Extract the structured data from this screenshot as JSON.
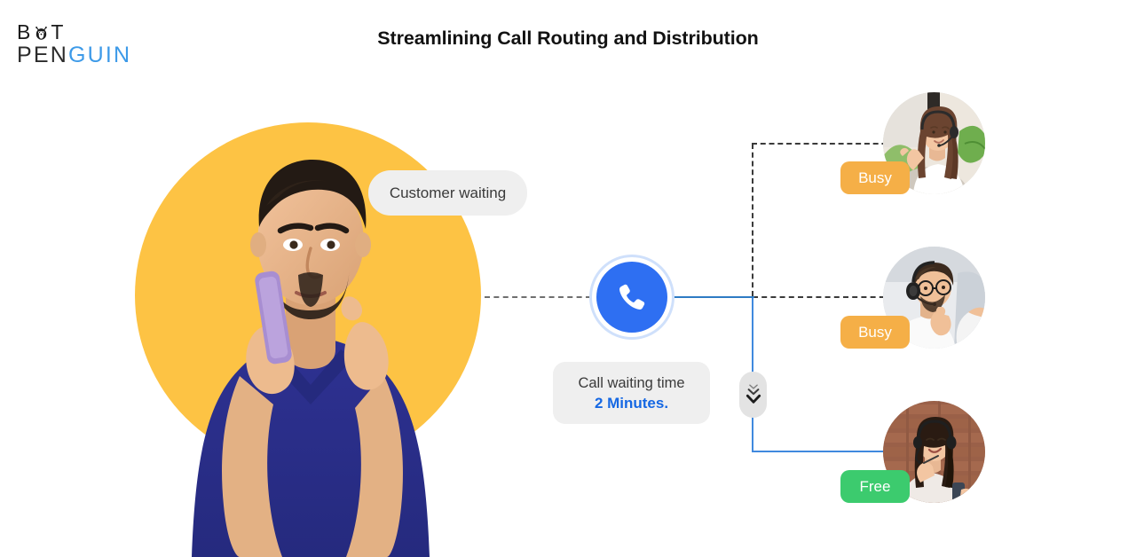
{
  "brand": {
    "line1_pre": "B",
    "line1_post": "T",
    "line2_dark": "PEN",
    "line2_accent": "GUIN",
    "accent_color": "#3d9ae8",
    "icon": "penguin-icon"
  },
  "header": {
    "title": "Streamlining Call Routing and Distribution"
  },
  "customer": {
    "bubble_label": "Customer waiting",
    "photo_alt": "man-on-phone-photo",
    "circle_color": "#FDC344"
  },
  "hub": {
    "icon": "phone-icon",
    "color": "#2E6FF2",
    "ring_color": "#cfe0fb"
  },
  "call_waiting": {
    "label": "Call waiting time",
    "value": "2 Minutes.",
    "value_color": "#1668E3"
  },
  "queue_indicator": {
    "icon": "double-chevron-down-icon"
  },
  "agents": [
    {
      "id": "agent-1",
      "status": "Busy",
      "status_type": "busy",
      "status_color": "#F5AF47",
      "photo_alt": "female-agent-headset-plants-photo",
      "connector": "dashed"
    },
    {
      "id": "agent-2",
      "status": "Busy",
      "status_type": "busy",
      "status_color": "#F5AF47",
      "photo_alt": "male-agent-glasses-headset-photo",
      "connector": "dashed"
    },
    {
      "id": "agent-3",
      "status": "Free",
      "status_type": "free",
      "status_color": "#3CCB6E",
      "photo_alt": "female-agent-smiling-brick-wall-photo",
      "connector": "solid-blue"
    }
  ],
  "connectors": {
    "customer_to_hub": "dashed",
    "hub_to_branch": "solid-blue",
    "dashed_color": "#3b3b3b",
    "blue_color": "#4089DE"
  }
}
